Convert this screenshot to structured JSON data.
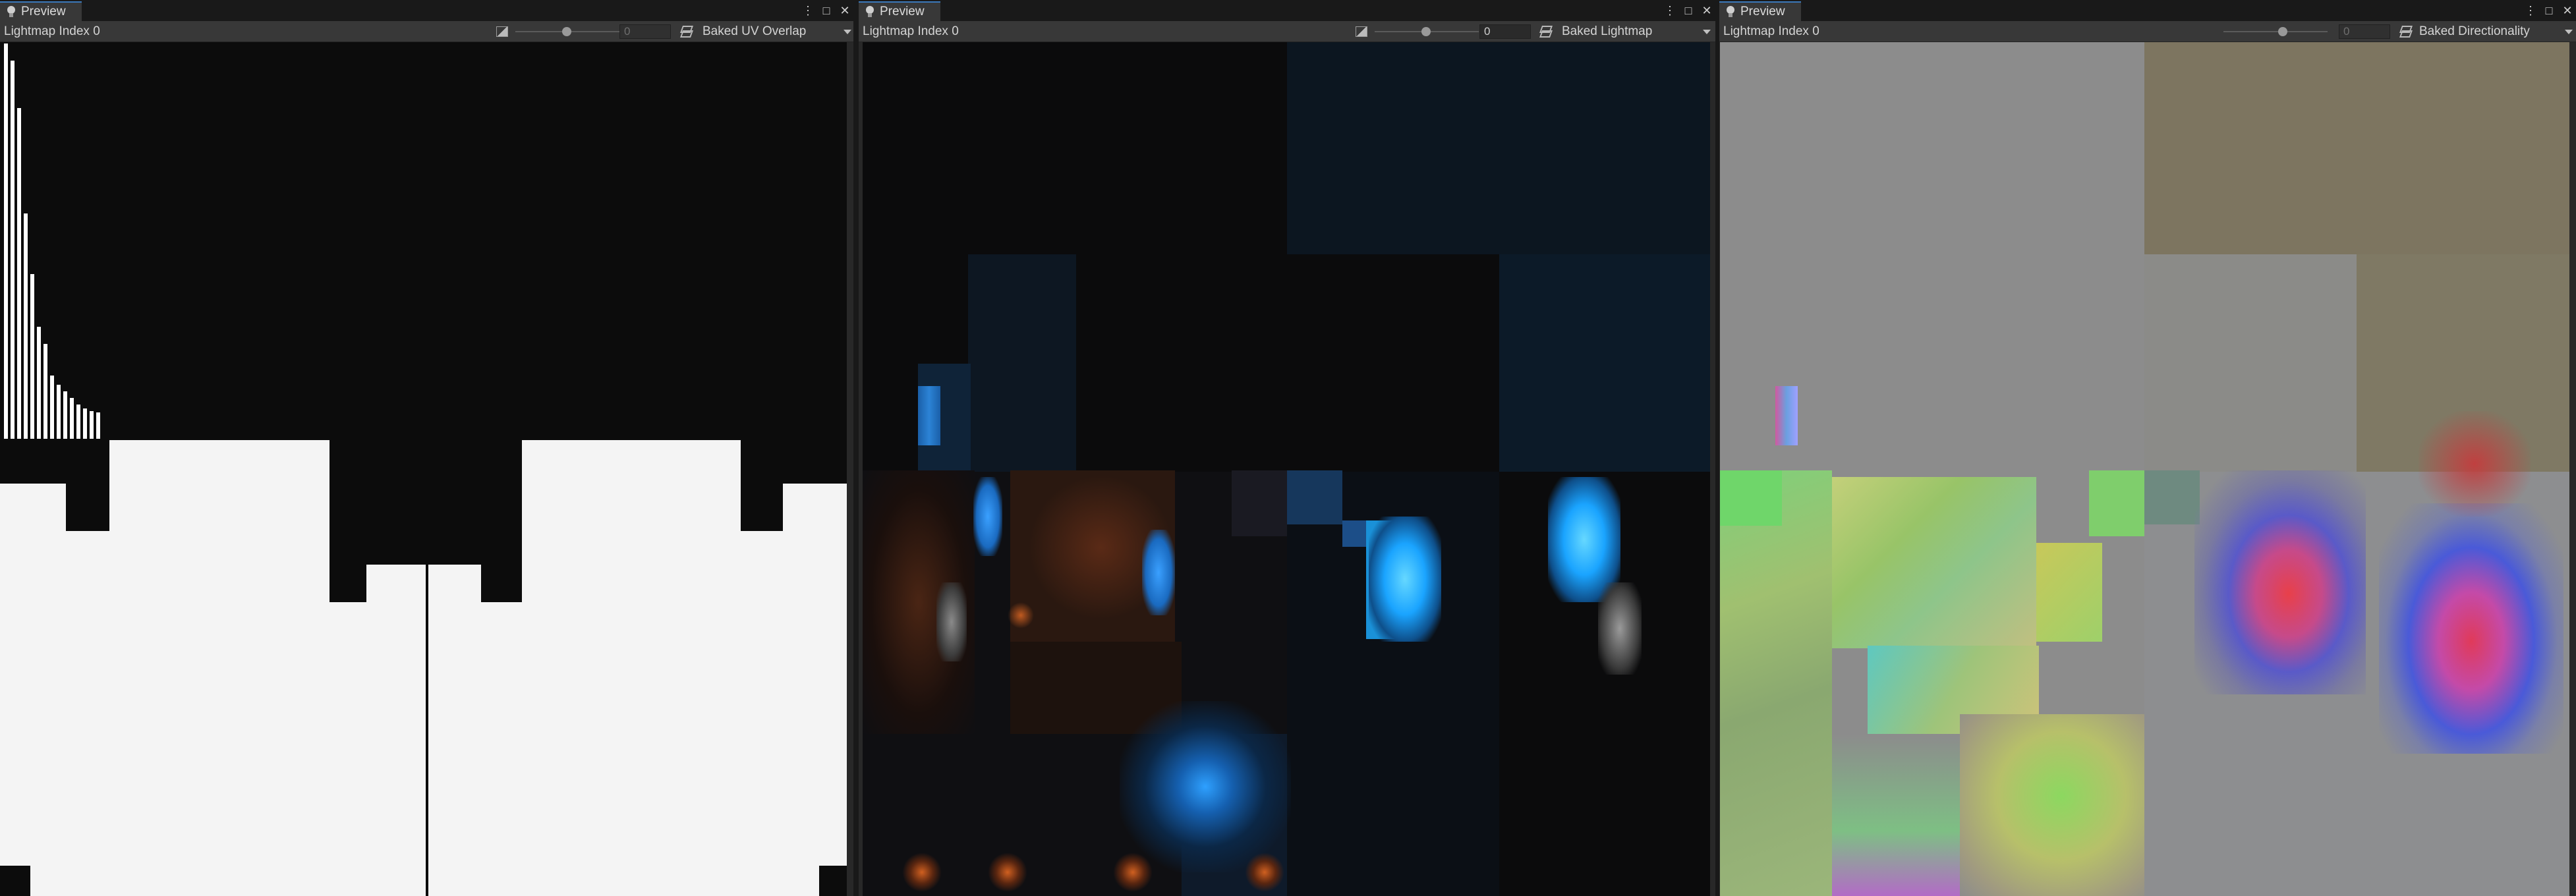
{
  "panels": [
    {
      "tab_label": "Preview",
      "lightmap_label": "Lightmap Index 0",
      "exposure_value": "0",
      "mode_label": "Baked UV Overlap"
    },
    {
      "tab_label": "Preview",
      "lightmap_label": "Lightmap Index 0",
      "exposure_value": "0",
      "mode_label": "Baked Lightmap"
    },
    {
      "tab_label": "Preview",
      "lightmap_label": "Lightmap Index 0",
      "exposure_value": "0",
      "mode_label": "Baked Directionality"
    }
  ],
  "window_buttons": {
    "menu": "⋮",
    "maximize": "□",
    "close": "✕"
  },
  "icons": {
    "tab": "lightbulb-icon",
    "exposure": "exposure-icon",
    "mode": "layers-icon",
    "dropdown": "chevron-down-icon"
  },
  "colors": {
    "uv_overlap_background": "#0c0c0c",
    "uv_overlap_charts": "#f4f4f4",
    "accent_tab_border": "#3a79bb"
  }
}
